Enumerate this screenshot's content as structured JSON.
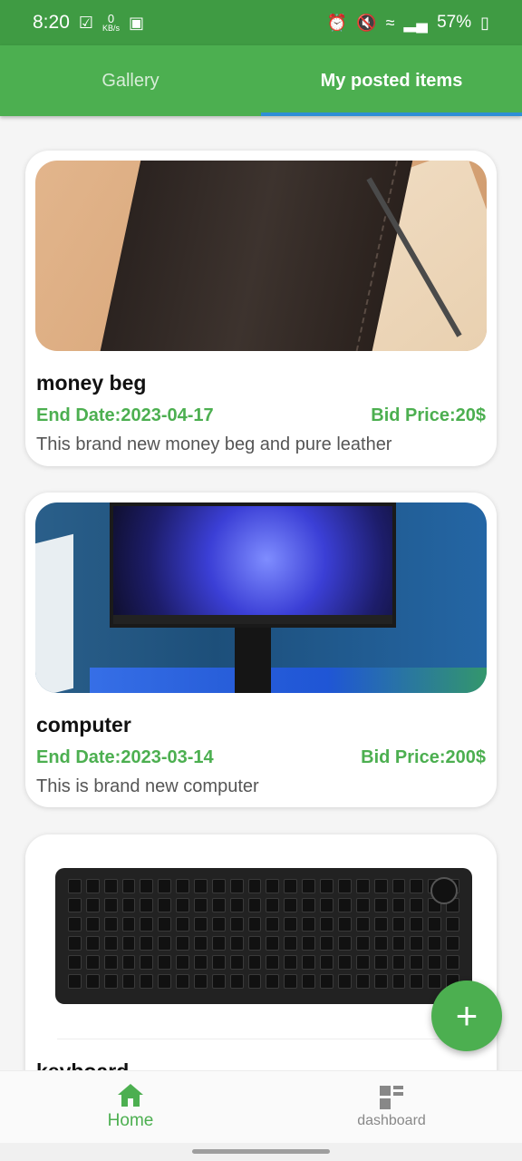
{
  "status_bar": {
    "time": "8:20",
    "net_speed_value": "0",
    "net_speed_unit": "KB/s",
    "battery": "57%"
  },
  "tabs": [
    {
      "label": "Gallery",
      "active": false
    },
    {
      "label": "My posted items",
      "active": true
    }
  ],
  "items": [
    {
      "title": "money beg",
      "end_date": "End Date:2023-04-17",
      "bid_price": "Bid Price:20$",
      "description": "This brand new money beg and pure leather"
    },
    {
      "title": "computer",
      "end_date": "End Date:2023-03-14",
      "bid_price": "Bid Price:200$",
      "description": "This is brand new computer"
    },
    {
      "title": "keyboard",
      "end_date": "",
      "bid_price": "",
      "description": ""
    }
  ],
  "fab": {
    "symbol": "+"
  },
  "bottom_nav": [
    {
      "label": "Home",
      "icon": "home-icon",
      "active": true
    },
    {
      "label": "dashboard",
      "icon": "dashboard-icon",
      "active": false
    }
  ],
  "colors": {
    "primary": "#4caf50",
    "status_bar": "#3f9b43",
    "tab_indicator": "#2f8fd6"
  }
}
